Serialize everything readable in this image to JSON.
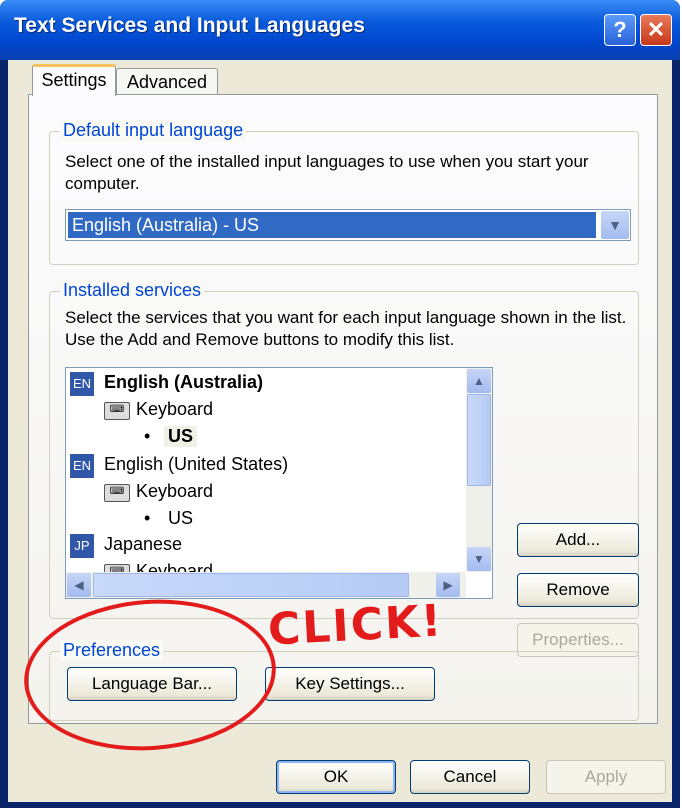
{
  "window": {
    "title": "Text Services and Input Languages",
    "help_label": "?",
    "close_label": "✕"
  },
  "tabs": [
    {
      "label": "Settings"
    },
    {
      "label": "Advanced"
    }
  ],
  "default_input": {
    "group_label": "Default input language",
    "description": "Select one of the installed input languages to use when you start your computer.",
    "selected_value": "English (Australia) - US"
  },
  "installed_services": {
    "group_label": "Installed services",
    "description": "Select the services that you want for each input language shown in the list. Use the Add and Remove buttons to modify this list.",
    "languages": [
      {
        "code": "EN",
        "name": "English (Australia)",
        "service": "Keyboard",
        "layout": "US"
      },
      {
        "code": "EN",
        "name": "English (United States)",
        "service": "Keyboard",
        "layout": "US"
      },
      {
        "code": "JP",
        "name": "Japanese",
        "service": "Keyboard"
      }
    ],
    "add_label": "Add...",
    "remove_label": "Remove",
    "properties_label": "Properties..."
  },
  "preferences": {
    "group_label": "Preferences",
    "language_bar_label": "Language Bar...",
    "key_settings_label": "Key Settings..."
  },
  "footer": {
    "ok_label": "OK",
    "cancel_label": "Cancel",
    "apply_label": "Apply"
  },
  "annotation": {
    "text": "CLICK!",
    "color": "#e41b1b"
  }
}
